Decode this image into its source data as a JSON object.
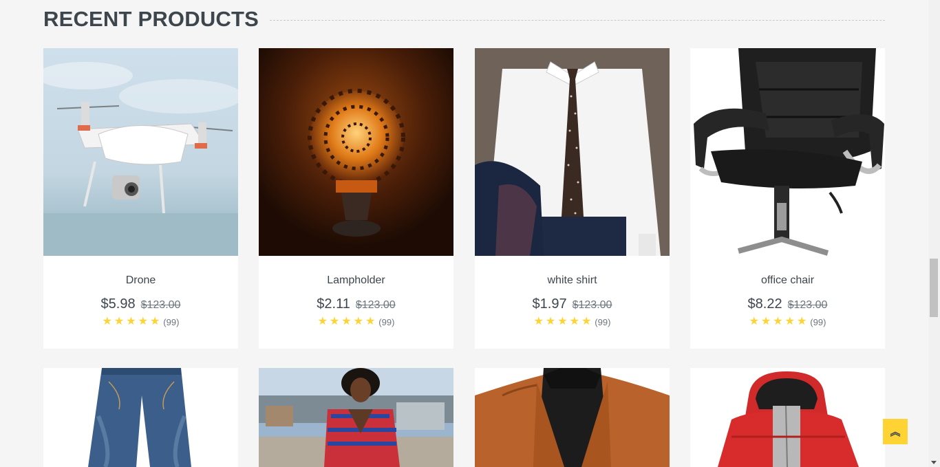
{
  "section": {
    "title": "RECENT PRODUCTS"
  },
  "products": [
    {
      "name": "Drone",
      "price": "$5.98",
      "old_price": "$123.00",
      "rating_count": "(99)",
      "stars": 5,
      "image": "drone"
    },
    {
      "name": "Lampholder",
      "price": "$2.11",
      "old_price": "$123.00",
      "rating_count": "(99)",
      "stars": 5,
      "image": "lamp"
    },
    {
      "name": "white shirt",
      "price": "$1.97",
      "old_price": "$123.00",
      "rating_count": "(99)",
      "stars": 5,
      "image": "shirt"
    },
    {
      "name": "office chair",
      "price": "$8.22",
      "old_price": "$123.00",
      "rating_count": "(99)",
      "stars": 5,
      "image": "chair"
    },
    {
      "image": "jeans"
    },
    {
      "image": "dress"
    },
    {
      "image": "blazer"
    },
    {
      "image": "jacket"
    }
  ],
  "back_to_top": {
    "icon": "double-chevron-up-icon",
    "glyph": "︽"
  },
  "colors": {
    "accent": "#ffd333",
    "text": "#3d464d",
    "muted": "#6c757d",
    "background": "#f5f5f5"
  }
}
